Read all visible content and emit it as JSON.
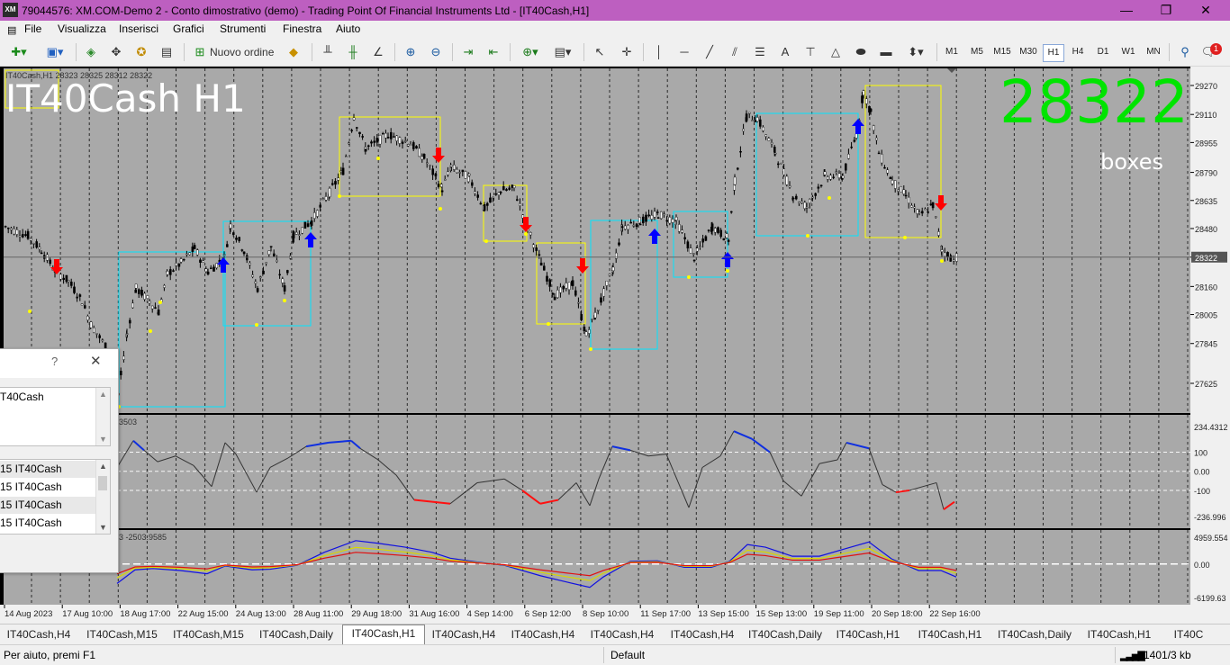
{
  "window": {
    "title": "79044576: XM.COM-Demo 2 - Conto dimostrativo (demo) - Trading Point Of Financial Instruments Ltd - [IT40Cash,H1]",
    "logo": "XM",
    "min_glyph": "—",
    "restore_glyph": "❐",
    "close_glyph": "✕"
  },
  "menu": [
    "File",
    "Visualizza",
    "Inserisci",
    "Grafici",
    "Strumenti",
    "Finestra",
    "Aiuto"
  ],
  "toolbar": {
    "new_order_label": "Nuovo ordine",
    "timeframes": [
      "M1",
      "M5",
      "M15",
      "M30",
      "H1",
      "H4",
      "D1",
      "W1",
      "MN"
    ],
    "active_timeframe": "H1",
    "notification_count": "1"
  },
  "chart": {
    "info_line": "IT40Cash,H1  28323 28325 28312 28322",
    "symbol_label": "IT40Cash H1",
    "big_price": "28322",
    "big_price_color": "#00e400",
    "boxes_label": "boxes",
    "background": "#a9a9a9",
    "price_axis": [
      "29270",
      "29110",
      "28955",
      "28790",
      "28635",
      "28480",
      "28322",
      "28160",
      "28005",
      "27845",
      "27625"
    ],
    "current_price_tag": "28322",
    "ind1_label": "3503",
    "ind1_axis": [
      "234.4312",
      "100",
      "0.00",
      "-100",
      "-236.996"
    ],
    "ind2_label": "3 -2503.9585",
    "ind2_axis": [
      "4959.554",
      "0.00",
      "-6199.63"
    ],
    "time_labels": [
      "14 Aug 2023",
      "17 Aug 10:00",
      "18 Aug 17:00",
      "22 Aug 15:00",
      "24 Aug 13:00",
      "28 Aug 11:00",
      "29 Aug 18:00",
      "31 Aug 16:00",
      "4 Sep 14:00",
      "6 Sep 12:00",
      "8 Sep 10:00",
      "11 Sep 17:00",
      "13 Sep 15:00",
      "15 Sep 13:00",
      "19 Sep 11:00",
      "20 Sep 18:00",
      "22 Sep 16:00"
    ],
    "colors": {
      "up_arrow": "#0000ff",
      "down_arrow": "#ff0000",
      "box_yellow": "#ffff00",
      "box_cyan": "#00e5ff"
    }
  },
  "dialog": {
    "help_glyph": "?",
    "close_glyph": "✕",
    "symbol_text": "T40Cash",
    "rows": [
      "15 IT40Cash",
      "15 IT40Cash",
      "15 IT40Cash",
      "15 IT40Cash"
    ]
  },
  "tabs": [
    "IT40Cash,H4",
    "IT40Cash,M15",
    "IT40Cash,M15",
    "IT40Cash,Daily",
    "IT40Cash,H1",
    "IT40Cash,H4",
    "IT40Cash,H4",
    "IT40Cash,H4",
    "IT40Cash,H4",
    "IT40Cash,Daily",
    "IT40Cash,H1",
    "IT40Cash,H1",
    "IT40Cash,Daily",
    "IT40Cash,H1",
    "IT40C"
  ],
  "active_tab_index": 4,
  "status": {
    "help": "Per aiuto, premi F1",
    "profile": "Default",
    "traffic": "1401/3 kb"
  }
}
